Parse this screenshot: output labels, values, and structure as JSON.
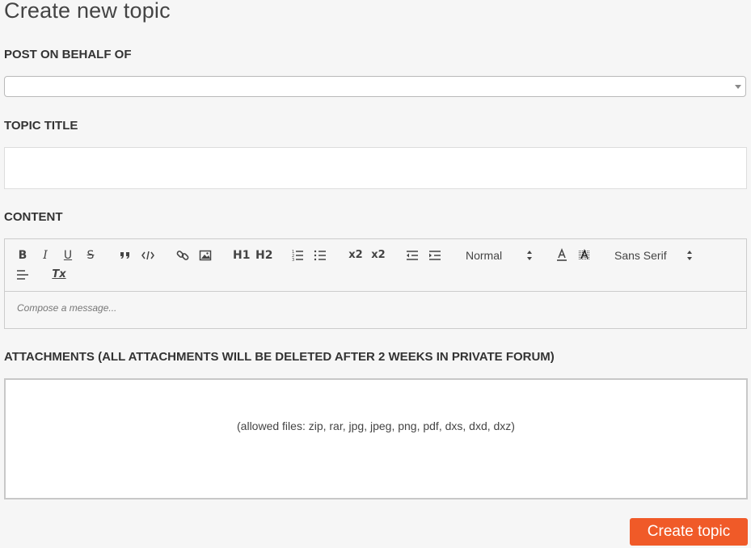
{
  "page": {
    "title": "Create new topic"
  },
  "form": {
    "behalf_label": "POST ON BEHALF OF",
    "behalf_value": "",
    "title_label": "TOPIC TITLE",
    "title_value": "",
    "content_label": "CONTENT",
    "editor": {
      "toolbar": {
        "bold": "B",
        "italic": "I",
        "underline": "U",
        "strike": "S",
        "header1": "H1",
        "header2": "H2",
        "subscript": "x2",
        "superscript": "x2",
        "size_value": "Normal",
        "font_value": "Sans Serif",
        "clean": "Tx"
      },
      "placeholder": "Compose a message..."
    },
    "attachments_label": "ATTACHMENTS (ALL ATTACHMENTS WILL BE DELETED AFTER 2 WEEKS IN PRIVATE FORUM)",
    "attachments_hint": "(allowed files: zip, rar, jpg, jpeg, png, pdf, dxs, dxd, dxz)",
    "submit_label": "Create topic"
  },
  "icons": {
    "blockquote": "quote-icon",
    "code": "code-icon",
    "link": "link-icon",
    "image": "image-icon",
    "ordered_list": "ordered-list-icon",
    "bullet_list": "bullet-list-icon",
    "outdent": "outdent-icon",
    "indent": "indent-icon",
    "color": "text-color-icon",
    "background": "background-color-icon",
    "align": "align-left-icon"
  },
  "colors": {
    "accent": "#f05a28",
    "background": "#f6f6f6"
  }
}
